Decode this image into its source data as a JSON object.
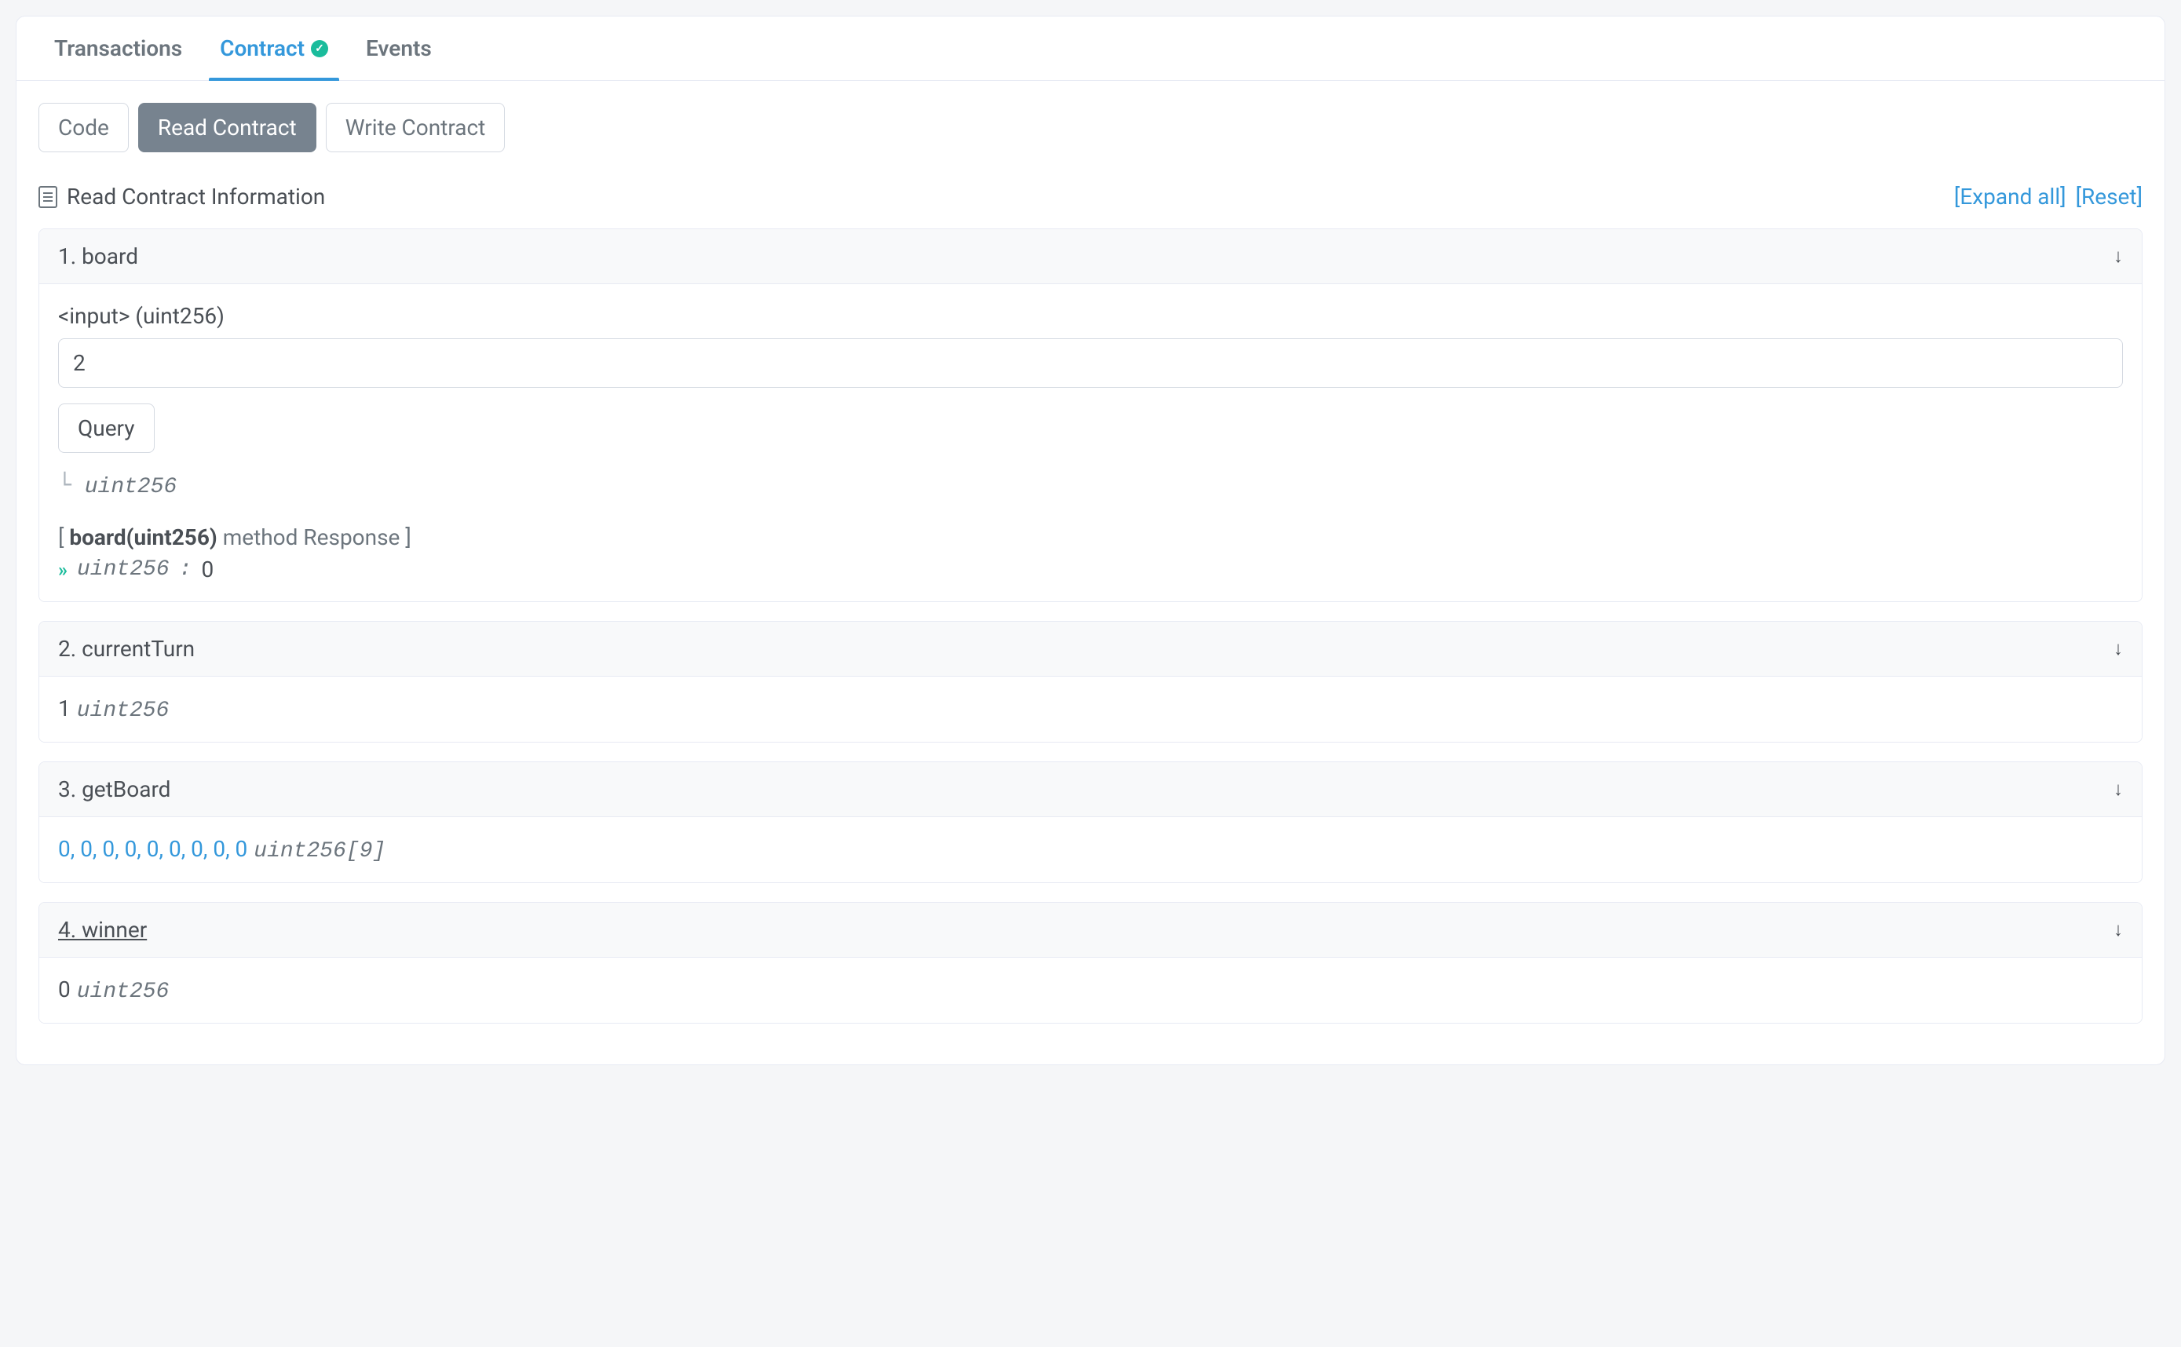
{
  "tabs": {
    "transactions": "Transactions",
    "contract": "Contract",
    "events": "Events"
  },
  "subTabs": {
    "code": "Code",
    "read": "Read Contract",
    "write": "Write Contract"
  },
  "section": {
    "title": "Read Contract Information",
    "expandAll": "[Expand all]",
    "reset": "[Reset]"
  },
  "accordions": {
    "board": {
      "title": "1. board",
      "inputLabel": "<input> (uint256)",
      "inputValue": "2",
      "queryBtn": "Query",
      "returnType": "uint256",
      "responseLabelPrefix": "[ ",
      "responseLabelBold": "board(uint256)",
      "responseLabelSuffix": " method Response ]",
      "responseType": "uint256",
      "responseColon": ":",
      "responseValue": "0"
    },
    "currentTurn": {
      "title": "2. currentTurn",
      "value": "1",
      "type": "uint256"
    },
    "getBoard": {
      "title": "3. getBoard",
      "value": "0, 0, 0, 0, 0, 0, 0, 0, 0",
      "type": "uint256[9]"
    },
    "winner": {
      "title": "4. winner",
      "value": "0",
      "type": "uint256"
    }
  }
}
